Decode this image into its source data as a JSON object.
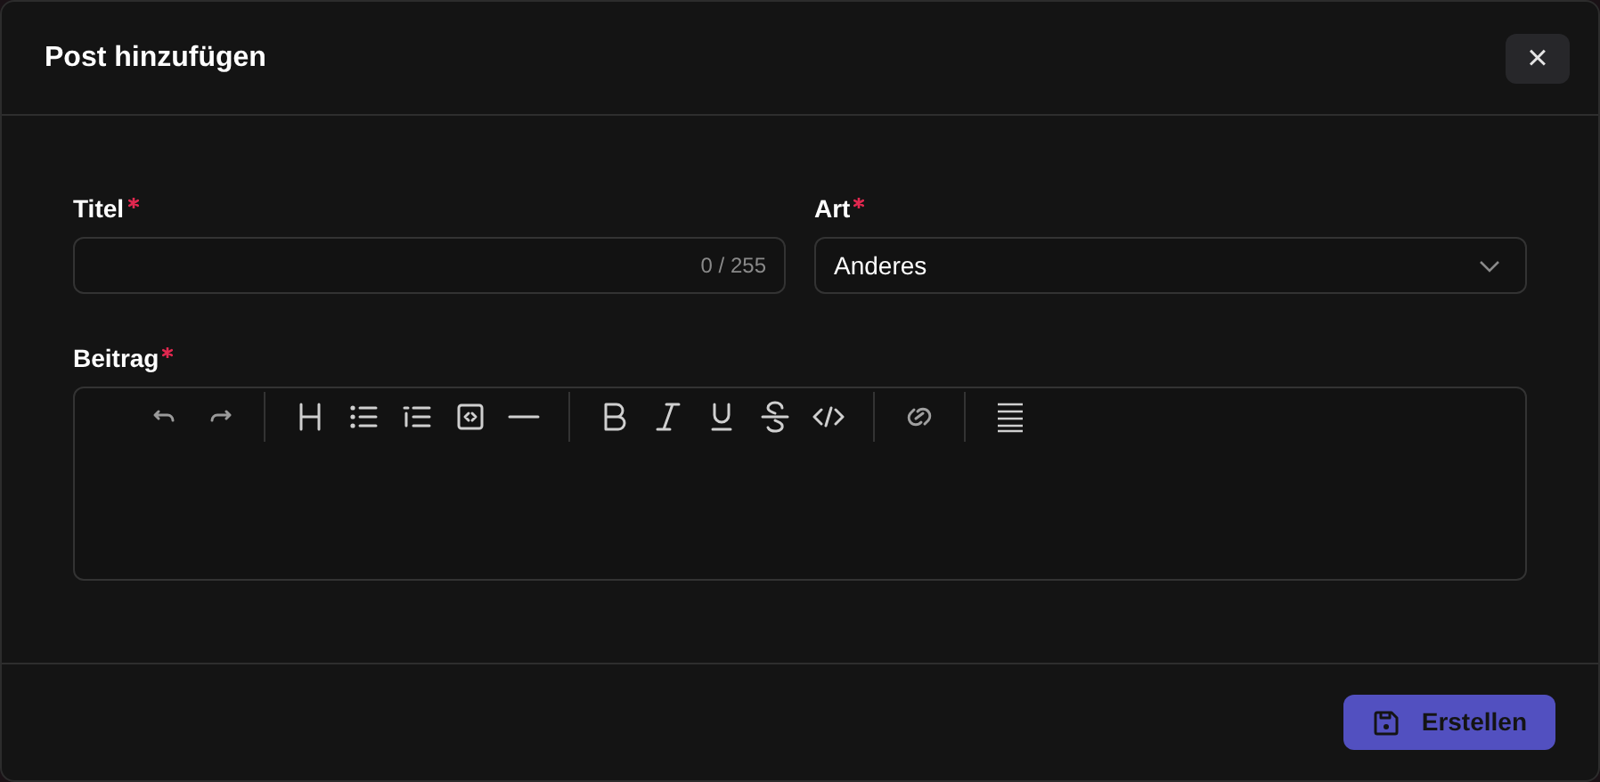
{
  "dialog": {
    "title": "Post hinzufügen",
    "close_label": "×"
  },
  "fields": [
    {
      "kind": "text",
      "label": "Titel",
      "required": true,
      "counter": "0 / 255"
    },
    {
      "kind": "select",
      "label": "Art",
      "required": true,
      "value": "Anderes"
    }
  ],
  "editor": {
    "label": "Beitrag",
    "required": true
  },
  "submit": {
    "label": "Erstellen"
  }
}
